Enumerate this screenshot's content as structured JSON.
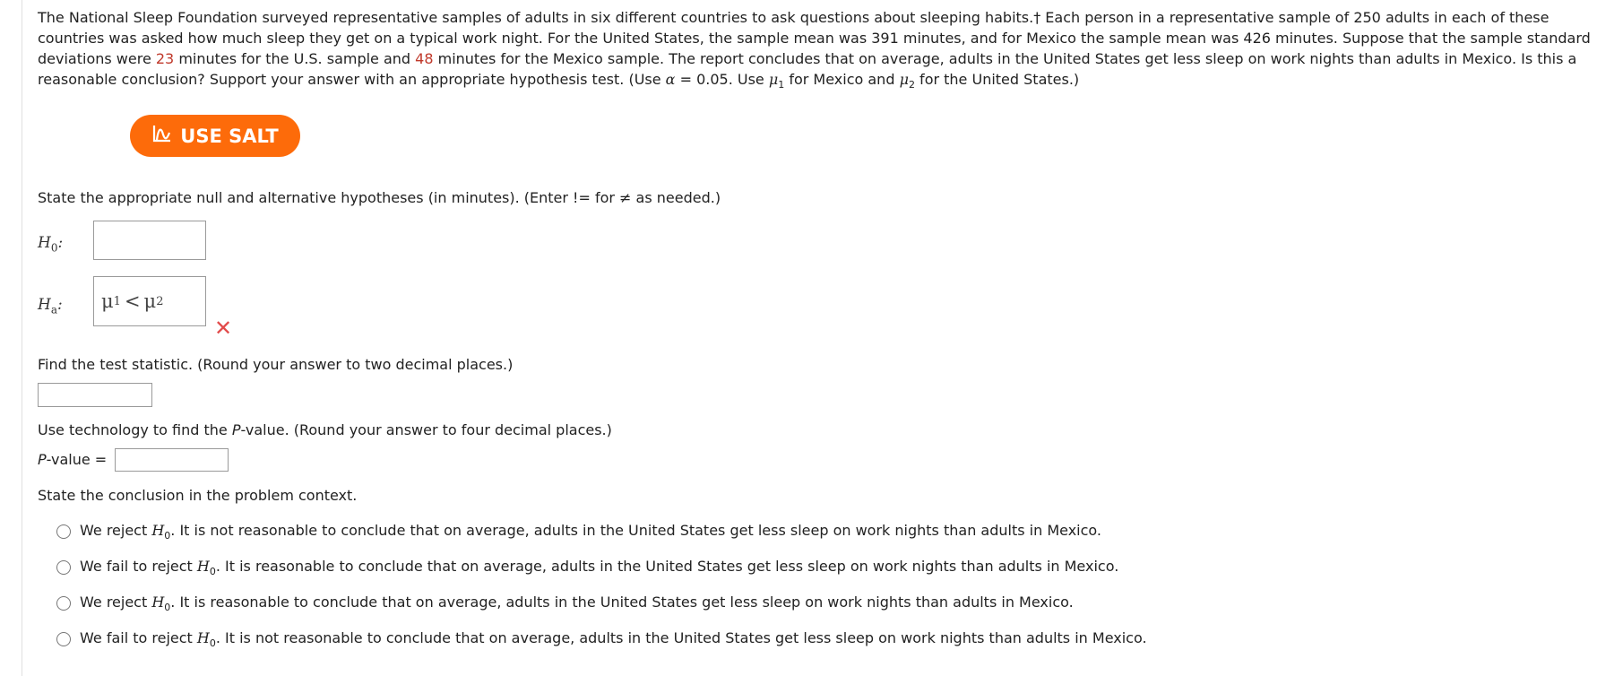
{
  "problem": {
    "part1": "The National Sleep Foundation surveyed representative samples of adults in six different countries to ask questions about sleeping habits.† Each person in a representative sample of 250 adults in each of these countries was asked how much sleep they get on a typical work night. For the United States, the sample mean was 391 minutes, and for Mexico the sample mean was 426 minutes. Suppose that the sample standard deviations were ",
    "sd_us": "23",
    "part2": " minutes for the U.S. sample and ",
    "sd_mexico": "48",
    "part3": " minutes for the Mexico sample. The report concludes that on average, adults in the United States get less sleep on work nights than adults in Mexico. Is this a reasonable conclusion? Support your answer with an appropriate hypothesis test. (Use ",
    "alpha_sym": "α",
    "alpha_val": " = 0.05. Use ",
    "mu": "μ",
    "sub1": "1",
    "part4": " for Mexico and ",
    "sub2": "2",
    "part5": " for the United States.)"
  },
  "salt_button": {
    "label": "USE SALT",
    "icon": "salt-icon"
  },
  "hypotheses": {
    "prompt": "State the appropriate null and alternative hypotheses (in minutes). (Enter != for ≠ as needed.)",
    "h0_label": "H",
    "h0_sub": "0",
    "h0_value": "",
    "ha_label": "H",
    "ha_sub": "a",
    "ha_value": {
      "mu": "μ",
      "sub1": "1",
      "op": "<",
      "sub2": "2"
    },
    "ha_status": "incorrect",
    "ha_status_icon": "x-mark-icon",
    "status_color": "#e24b4b"
  },
  "test_statistic": {
    "prompt": "Find the test statistic. (Round your answer to two decimal places.)",
    "value": ""
  },
  "p_value": {
    "prompt_pre": "Use technology to find the ",
    "prompt_italic": "P",
    "prompt_post": "-value. (Round your answer to four decimal places.)",
    "label_italic": "P",
    "label_rest": "-value =",
    "value": ""
  },
  "conclusion": {
    "prompt": "State the conclusion in the problem context.",
    "options": [
      {
        "pre": "We reject ",
        "h": "H",
        "sub": "0",
        "post": ". It is not reasonable to conclude that on average, adults in the United States get less sleep on work nights than adults in Mexico."
      },
      {
        "pre": "We fail to reject ",
        "h": "H",
        "sub": "0",
        "post": ". It is reasonable to conclude that on average, adults in the United States get less sleep on work nights than adults in Mexico."
      },
      {
        "pre": "We reject ",
        "h": "H",
        "sub": "0",
        "post": ". It is reasonable to conclude that on average, adults in the United States get less sleep on work nights than adults in Mexico."
      },
      {
        "pre": "We fail to reject ",
        "h": "H",
        "sub": "0",
        "post": ". It is not reasonable to conclude that on average, adults in the United States get less sleep on work nights than adults in Mexico."
      }
    ]
  },
  "colors": {
    "accent": "#fd6b0a",
    "highlight": "#c0392b"
  }
}
